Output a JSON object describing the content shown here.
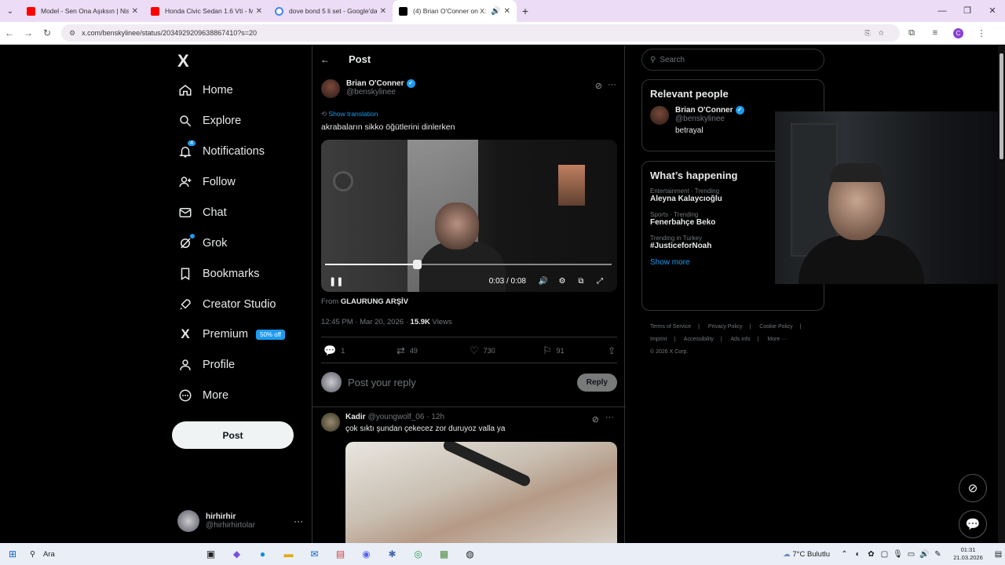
{
  "browser": {
    "tabs": [
      {
        "title": "Model - Sen Ona Aşıksın | Niss",
        "icon": "youtube-icon",
        "color": "#ff0000"
      },
      {
        "title": "Honda Civic Sedan 1.6 Vti - Mo",
        "icon": "youtube-icon",
        "color": "#ff0000"
      },
      {
        "title": "dove bond 5 li set - Google'da",
        "icon": "google-icon",
        "color": "#4285f4"
      },
      {
        "title": "(4) Brian O'Conner on X: \"ak",
        "icon": "x-icon",
        "color": "#000000"
      }
    ],
    "url": "x.com/benskylinee/status/2034929209638867410?s=20"
  },
  "sidebar": {
    "logo": "X",
    "items": [
      {
        "label": "Home",
        "icon": "home-icon"
      },
      {
        "label": "Explore",
        "icon": "search-icon"
      },
      {
        "label": "Notifications",
        "icon": "bell-icon"
      },
      {
        "label": "Follow",
        "icon": "person-add-icon"
      },
      {
        "label": "Chat",
        "icon": "mail-icon"
      },
      {
        "label": "Grok",
        "icon": "grok-icon"
      },
      {
        "label": "Bookmarks",
        "icon": "bookmark-icon"
      },
      {
        "label": "Creator Studio",
        "icon": "rocket-icon"
      },
      {
        "label": "Premium",
        "icon": "x-icon"
      },
      {
        "label": "Profile",
        "icon": "person-icon"
      },
      {
        "label": "More",
        "icon": "more-circle-icon"
      }
    ],
    "notif_count": "4",
    "premium_badge": "50% off",
    "post_button": "Post",
    "account": {
      "name": "hirhirhir",
      "handle": "@hirhirhirtolar"
    }
  },
  "post": {
    "header": "Post",
    "author": "Brian O'Conner",
    "handle": "@benskylinee",
    "show_translation": "Show translation",
    "text": "akrabaların sikko öğütlerini dinlerken",
    "video": {
      "current": "0:03",
      "duration": "0:08",
      "time_display": "0:03 / 0:08",
      "progress": 0.32
    },
    "from_label": "From",
    "from_source": "GLAURUNG ARŞİV",
    "timestamp": "12:45 PM · Mar 20, 2026 · ",
    "views": "15.9K",
    "views_label": " Views",
    "stats": {
      "replies": "1",
      "reposts": "49",
      "likes": "730",
      "bookmarks": "91"
    },
    "reply_placeholder": "Post your reply",
    "reply_button": "Reply"
  },
  "comment": {
    "name": "Kadir",
    "handle": "@youngwolf_06",
    "time": "· 12h",
    "text": "çok sıktı şundan çekecez zor duruyoz valla ya"
  },
  "right": {
    "search_placeholder": "Search",
    "relevant_title": "Relevant people",
    "relevant": {
      "name": "Brian O'Conner",
      "handle": "@benskylinee",
      "bio": "betrayal"
    },
    "happening_title": "What’s happening",
    "trends": [
      {
        "category": "Entertainment · Trending",
        "name": "Aleyna Kalaycıoğlu"
      },
      {
        "category": "Sports · Trending",
        "name": "Fenerbahçe Beko"
      },
      {
        "category": "Trending in Turkey",
        "name": "#JusticeforNoah"
      }
    ],
    "show_more": "Show more",
    "footer": [
      "Terms of Service",
      "|",
      "Privacy Policy",
      "|",
      "Cookie Policy",
      "|",
      "Imprint",
      "|",
      "Accessibility",
      "|",
      "Ads info",
      "|",
      "More ···",
      "© 2026 X Corp."
    ]
  },
  "taskbar": {
    "search": "Ara",
    "weather": "7°C  Bulutlu",
    "time": "01:31",
    "date": "21.03.2026"
  }
}
